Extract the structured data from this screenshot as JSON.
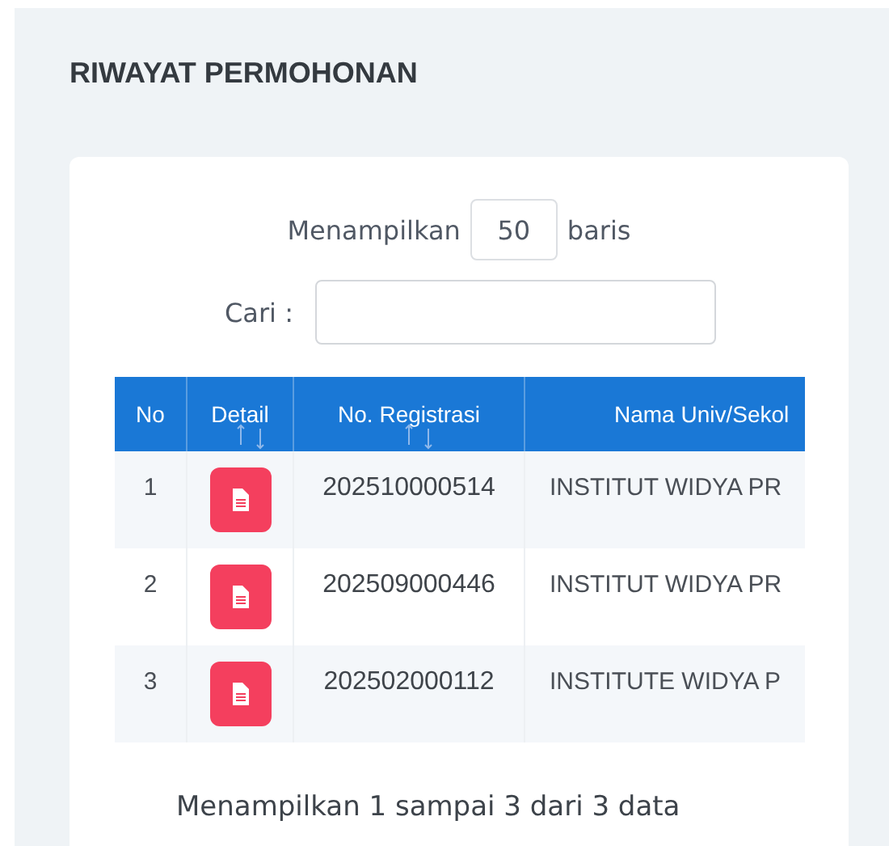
{
  "page_title": "RIWAYAT PERMOHONAN",
  "length_control": {
    "prefix": "Menampilkan",
    "value": "50",
    "suffix": "baris"
  },
  "search": {
    "label": "Cari :"
  },
  "table": {
    "columns": [
      {
        "label": "No",
        "sortable": false
      },
      {
        "label": "Detail",
        "sortable": true
      },
      {
        "label": "No. Registrasi",
        "sortable": true
      },
      {
        "label": "Nama Univ/Sekol",
        "sortable": false
      }
    ],
    "rows": [
      {
        "no": "1",
        "registration": "202510000514",
        "institution": "INSTITUT WIDYA PR"
      },
      {
        "no": "2",
        "registration": "202509000446",
        "institution": "INSTITUT WIDYA PR"
      },
      {
        "no": "3",
        "registration": "202502000112",
        "institution": "INSTITUTE WIDYA P"
      }
    ]
  },
  "info": "Menampilkan 1 sampai 3 dari 3 data"
}
